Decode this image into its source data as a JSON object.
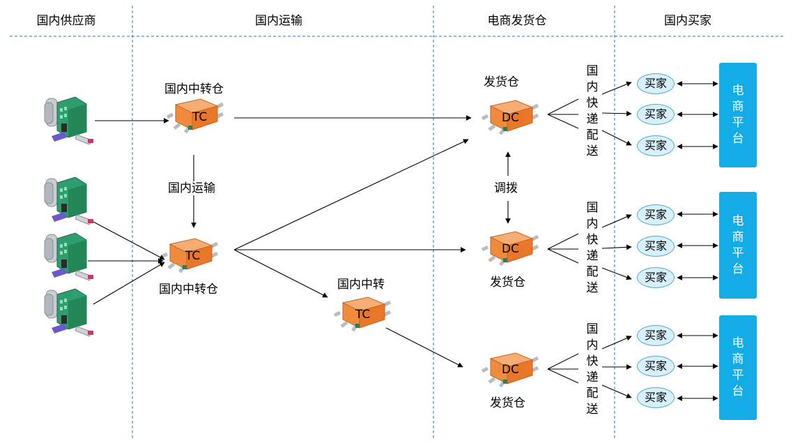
{
  "header": {
    "col1": "国内供应商",
    "col2": "国内运输",
    "col3": "电商发货仓",
    "col4": "国内买家"
  },
  "tc_labels": {
    "tc1": "国内中转仓",
    "tc2": "国内中转仓",
    "tc3": "国内中转"
  },
  "warehouse_icon_text": {
    "tc": "TC",
    "dc": "DC"
  },
  "dc_labels": {
    "dc1": "发货仓",
    "dc2": "发货仓",
    "dc3": "发货仓"
  },
  "edge_labels": {
    "domestic_transport": "国内运输",
    "allocation": "调拨",
    "express": "国内快递配送"
  },
  "buyer_label": "买家",
  "platform_label": "电商平台",
  "colors": {
    "divider": "#2e75b6",
    "platform": "#14ace6",
    "buyer_fill": "#d7f0fb",
    "warehouse": "#f08a3c",
    "factory": "#2f9e6e"
  }
}
